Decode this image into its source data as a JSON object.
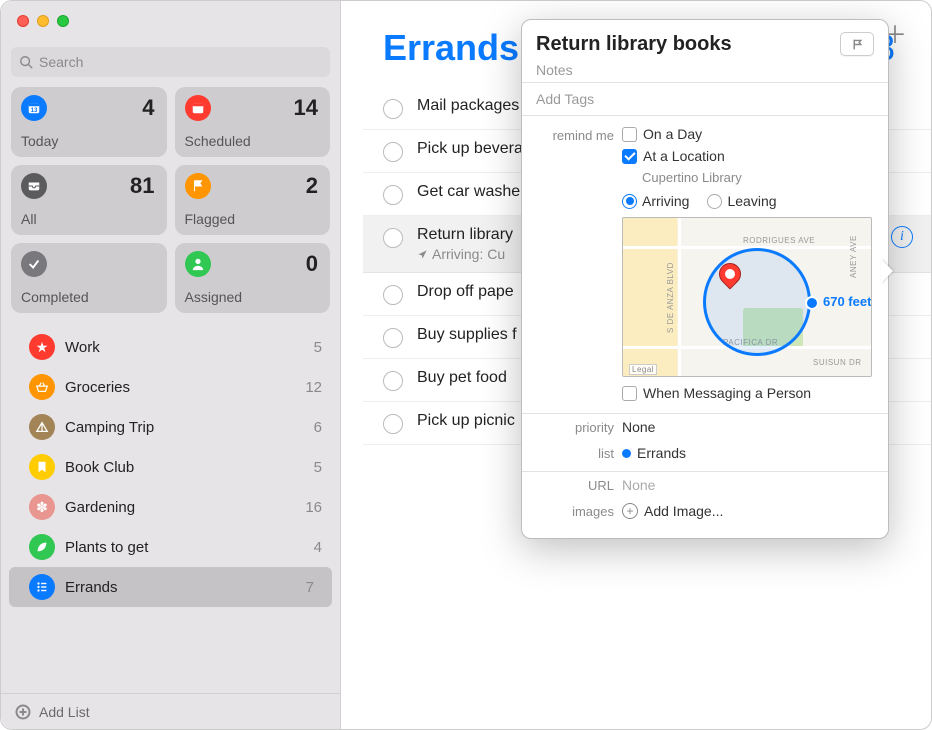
{
  "search": {
    "placeholder": "Search"
  },
  "smart_lists": [
    {
      "id": "today",
      "label": "Today",
      "count": 4,
      "color": "#0a7aff"
    },
    {
      "id": "scheduled",
      "label": "Scheduled",
      "count": 14,
      "color": "#ff3b30"
    },
    {
      "id": "all",
      "label": "All",
      "count": 81,
      "color": "#5b5b5e"
    },
    {
      "id": "flagged",
      "label": "Flagged",
      "count": 2,
      "color": "#ff9500"
    },
    {
      "id": "completed",
      "label": "Completed",
      "count": "",
      "color": "#79787d"
    },
    {
      "id": "assigned",
      "label": "Assigned",
      "count": 0,
      "color": "#30c752"
    }
  ],
  "my_lists": [
    {
      "name": "Work",
      "count": 5,
      "color": "#ff3b30"
    },
    {
      "name": "Groceries",
      "count": 12,
      "color": "#ff9500"
    },
    {
      "name": "Camping Trip",
      "count": 6,
      "color": "#a38457"
    },
    {
      "name": "Book Club",
      "count": 5,
      "color": "#ffcc00"
    },
    {
      "name": "Gardening",
      "count": 16,
      "color": "#e8968f"
    },
    {
      "name": "Plants to get",
      "count": 4,
      "color": "#30c752"
    },
    {
      "name": "Errands",
      "count": 7,
      "color": "#0a7aff",
      "selected": true
    }
  ],
  "add_list_label": "Add List",
  "main": {
    "title": "Errands",
    "count": 8,
    "reminders": [
      {
        "title": "Mail packages"
      },
      {
        "title": "Pick up bevera"
      },
      {
        "title": "Get car washe"
      },
      {
        "title": "Return library",
        "subtitle": "Arriving: Cu",
        "selected": true,
        "show_info": true
      },
      {
        "title": "Drop off pape"
      },
      {
        "title": "Buy supplies f"
      },
      {
        "title": "Buy pet food"
      },
      {
        "title": "Pick up picnic"
      }
    ]
  },
  "popover": {
    "title": "Return library books",
    "notes_placeholder": "Notes",
    "tags_placeholder": "Add Tags",
    "remind_label": "remind me",
    "on_day_label": "On a Day",
    "at_location_label": "At a Location",
    "location_name": "Cupertino Library",
    "arriving_label": "Arriving",
    "leaving_label": "Leaving",
    "geofence_distance": "670 feet",
    "messaging_label": "When Messaging a Person",
    "priority_label": "priority",
    "priority_value": "None",
    "list_label": "list",
    "list_value": "Errands",
    "url_label": "URL",
    "url_value": "None",
    "images_label": "images",
    "add_image_label": "Add Image...",
    "map_streets": {
      "rodrigues": "RODRIGUES AVE",
      "pacifica": "PACIFICA DR",
      "deanza": "S DE ANZA BLVD",
      "aney": "ANEY AVE",
      "suisun": "SUISUN DR",
      "legal": "Legal"
    }
  }
}
